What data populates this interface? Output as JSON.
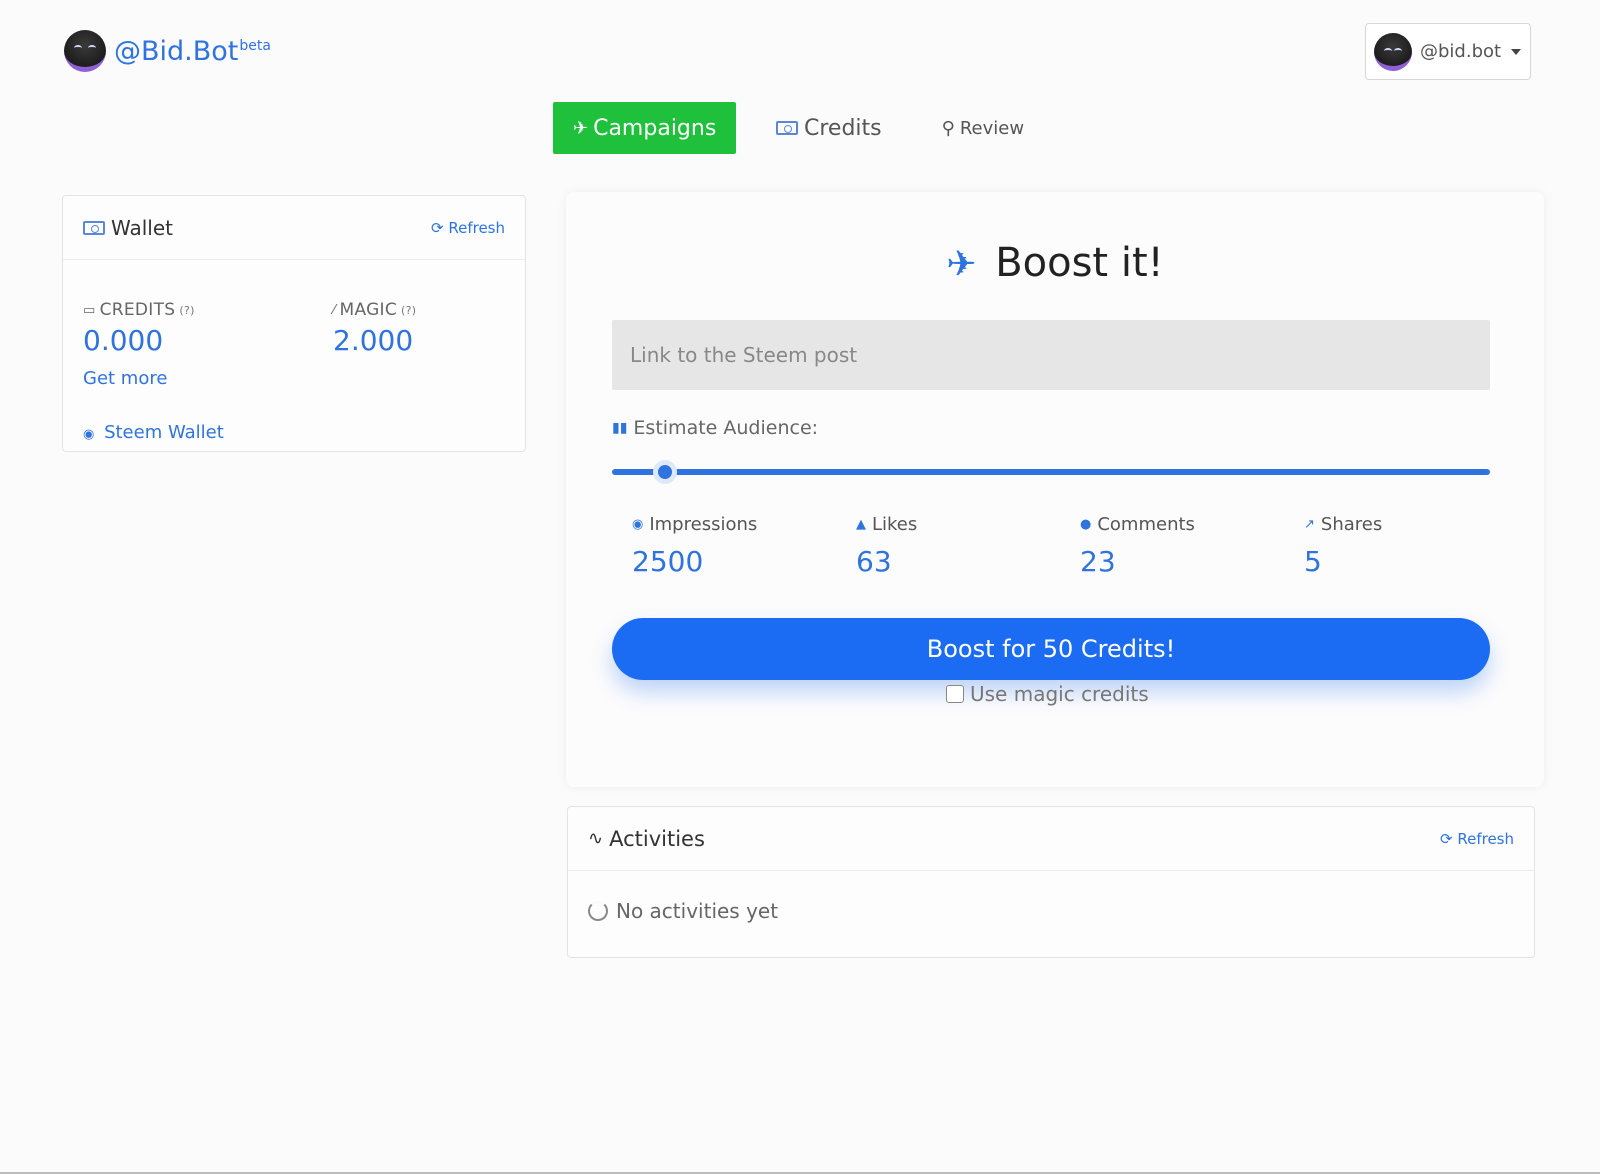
{
  "brand": {
    "name": "@Bid.Bot",
    "badge": "beta"
  },
  "user_menu": {
    "handle": "@bid.bot"
  },
  "nav": {
    "tabs": [
      {
        "label": "Campaigns",
        "icon": "rocket-icon",
        "active": true
      },
      {
        "label": "Credits",
        "icon": "money-icon",
        "active": false
      },
      {
        "label": "Review",
        "icon": "search-icon",
        "active": false
      }
    ]
  },
  "wallet": {
    "title": "Wallet",
    "refresh_label": "Refresh",
    "credits": {
      "label": "CREDITS",
      "hint": "(?)",
      "value": "0.000"
    },
    "magic": {
      "label": "MAGIC",
      "hint": "(?)",
      "value": "2.000"
    },
    "get_more_label": "Get more",
    "steem_wallet_label": "Steem Wallet"
  },
  "boost": {
    "title": "Boost it!",
    "post_placeholder": "Link to the Steem post",
    "audience_label": "Estimate Audience:",
    "slider_level_fraction": 0.06,
    "metrics": {
      "impressions": {
        "label": "Impressions",
        "value": "2500"
      },
      "likes": {
        "label": "Likes",
        "value": "63"
      },
      "comments": {
        "label": "Comments",
        "value": "23"
      },
      "shares": {
        "label": "Shares",
        "value": "5"
      }
    },
    "button_label": "Boost for 50 Credits!",
    "magic_toggle_label": "Use magic credits"
  },
  "activities": {
    "title": "Activities",
    "refresh_label": "Refresh",
    "empty_label": "No activities yet"
  },
  "colors": {
    "accent": "#2f73df",
    "primary_button": "#1b6cf2",
    "active_tab": "#1fc03b"
  }
}
